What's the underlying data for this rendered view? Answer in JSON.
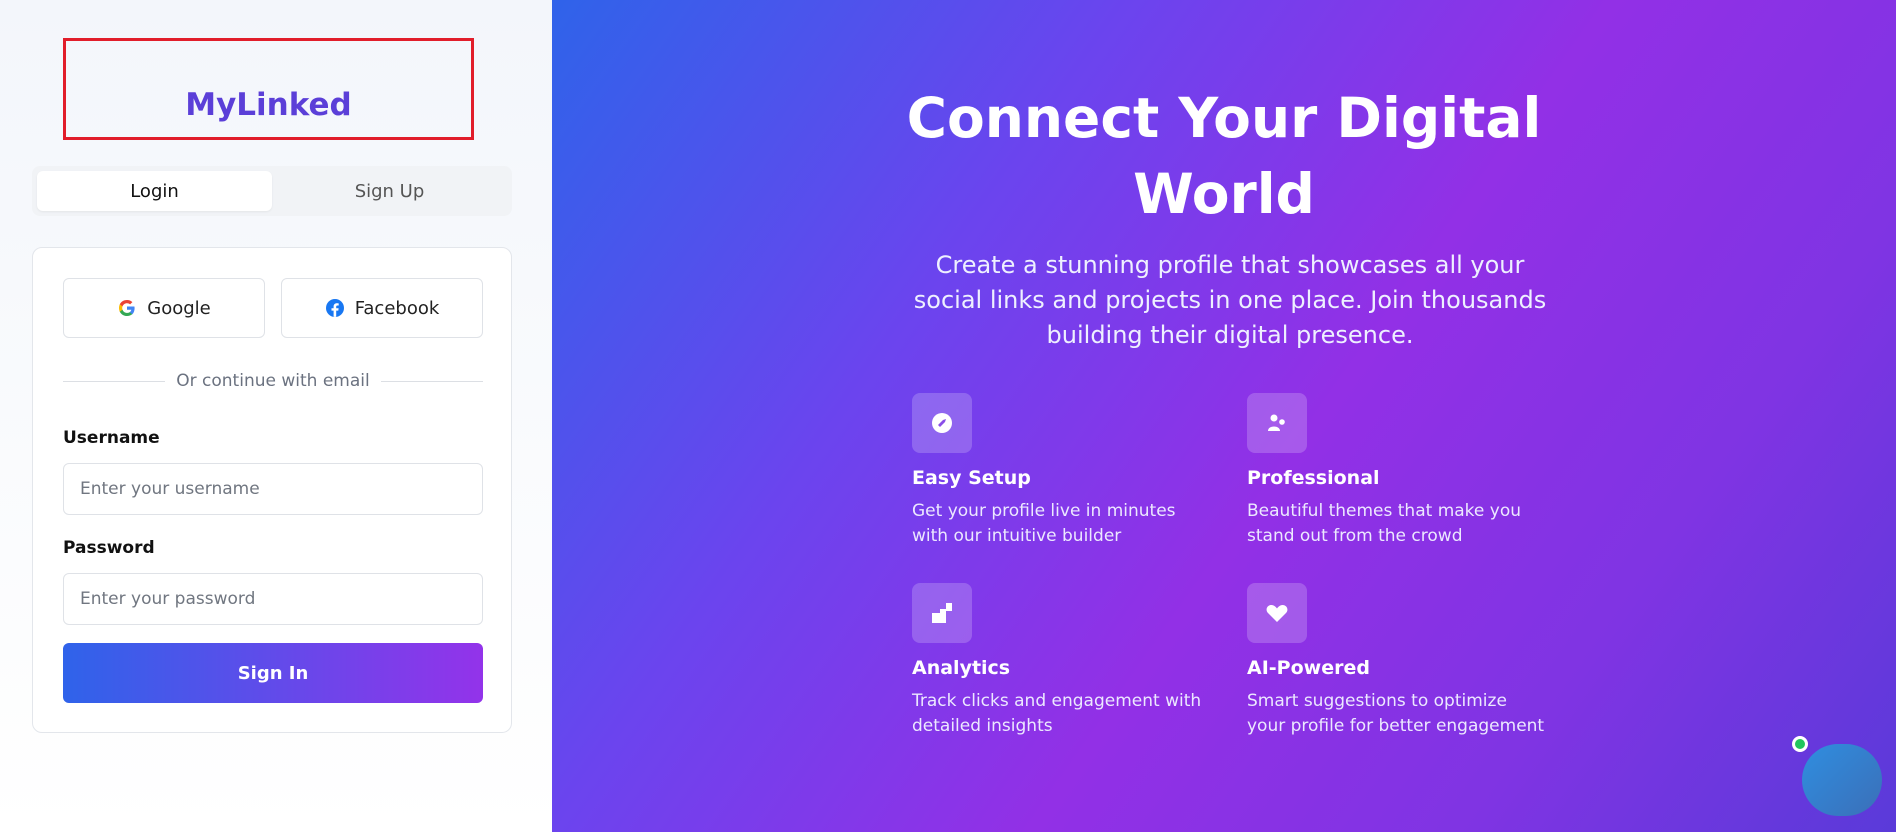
{
  "brand": {
    "name": "MyLinked"
  },
  "tabs": [
    {
      "label": "Login",
      "active": true
    },
    {
      "label": "Sign Up",
      "active": false
    }
  ],
  "social": {
    "google_label": "Google",
    "facebook_label": "Facebook"
  },
  "divider_text": "Or continue with email",
  "form": {
    "username_label": "Username",
    "username_placeholder": "Enter your username",
    "username_value": "",
    "password_label": "Password",
    "password_placeholder": "Enter your password",
    "password_value": "",
    "submit_label": "Sign In"
  },
  "hero": {
    "title": "Connect Your Digital World",
    "subtitle": "Create a stunning profile that showcases all your social links and projects in one place. Join thousands building their digital presence."
  },
  "features": [
    {
      "icon": "rocket-icon",
      "title": "Easy Setup",
      "desc": "Get your profile live in minutes with our intuitive builder"
    },
    {
      "icon": "users-icon",
      "title": "Professional",
      "desc": "Beautiful themes that make you stand out from the crowd"
    },
    {
      "icon": "chart-icon",
      "title": "Analytics",
      "desc": "Track clicks and engagement with detailed insights"
    },
    {
      "icon": "heart-icon",
      "title": "AI-Powered",
      "desc": "Smart suggestions to optimize your profile for better engagement"
    }
  ],
  "colors": {
    "brand": "#5b3fd8",
    "accent_start": "#2f63ea",
    "accent_end": "#9333ea",
    "highlight_border": "#e11d2a",
    "online": "#22c55e"
  }
}
